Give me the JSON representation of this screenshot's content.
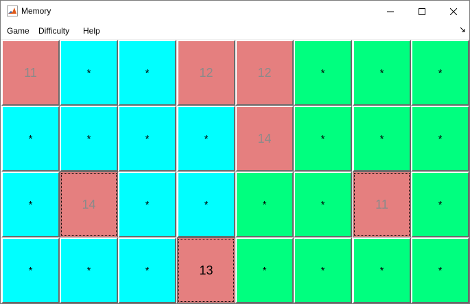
{
  "window": {
    "title": "Memory",
    "icon": "matlab-figure-icon",
    "controls": [
      "minimize-icon",
      "maximize-icon",
      "close-icon"
    ]
  },
  "menu": {
    "items": [
      "Game",
      "Difficulty",
      "Help"
    ]
  },
  "colors": {
    "pink": "#e57f7f",
    "cyan": "#00ffff",
    "green": "#00ff7f"
  },
  "board": {
    "rows": [
      [
        {
          "label": "11",
          "color": "pink",
          "state": "revealed"
        },
        {
          "label": "*",
          "color": "cyan",
          "state": "hidden"
        },
        {
          "label": "*",
          "color": "cyan",
          "state": "hidden"
        },
        {
          "label": "12",
          "color": "pink",
          "state": "revealed"
        },
        {
          "label": "12",
          "color": "pink",
          "state": "revealed"
        },
        {
          "label": "*",
          "color": "green",
          "state": "hidden"
        },
        {
          "label": "*",
          "color": "green",
          "state": "hidden"
        },
        {
          "label": "*",
          "color": "green",
          "state": "hidden"
        }
      ],
      [
        {
          "label": "*",
          "color": "cyan",
          "state": "hidden"
        },
        {
          "label": "*",
          "color": "cyan",
          "state": "hidden"
        },
        {
          "label": "*",
          "color": "cyan",
          "state": "hidden"
        },
        {
          "label": "*",
          "color": "cyan",
          "state": "hidden"
        },
        {
          "label": "14",
          "color": "pink",
          "state": "revealed"
        },
        {
          "label": "*",
          "color": "green",
          "state": "hidden"
        },
        {
          "label": "*",
          "color": "green",
          "state": "hidden"
        },
        {
          "label": "*",
          "color": "green",
          "state": "hidden"
        }
      ],
      [
        {
          "label": "*",
          "color": "cyan",
          "state": "hidden"
        },
        {
          "label": "14",
          "color": "pink",
          "state": "focused"
        },
        {
          "label": "*",
          "color": "cyan",
          "state": "hidden"
        },
        {
          "label": "*",
          "color": "cyan",
          "state": "hidden"
        },
        {
          "label": "*",
          "color": "green",
          "state": "hidden"
        },
        {
          "label": "*",
          "color": "green",
          "state": "hidden"
        },
        {
          "label": "11",
          "color": "pink",
          "state": "focused"
        },
        {
          "label": "*",
          "color": "green",
          "state": "hidden"
        }
      ],
      [
        {
          "label": "*",
          "color": "cyan",
          "state": "hidden"
        },
        {
          "label": "*",
          "color": "cyan",
          "state": "hidden"
        },
        {
          "label": "*",
          "color": "cyan",
          "state": "hidden"
        },
        {
          "label": "13",
          "color": "pink",
          "state": "selected"
        },
        {
          "label": "*",
          "color": "green",
          "state": "hidden"
        },
        {
          "label": "*",
          "color": "green",
          "state": "hidden"
        },
        {
          "label": "*",
          "color": "green",
          "state": "hidden"
        },
        {
          "label": "*",
          "color": "green",
          "state": "hidden"
        }
      ]
    ]
  }
}
